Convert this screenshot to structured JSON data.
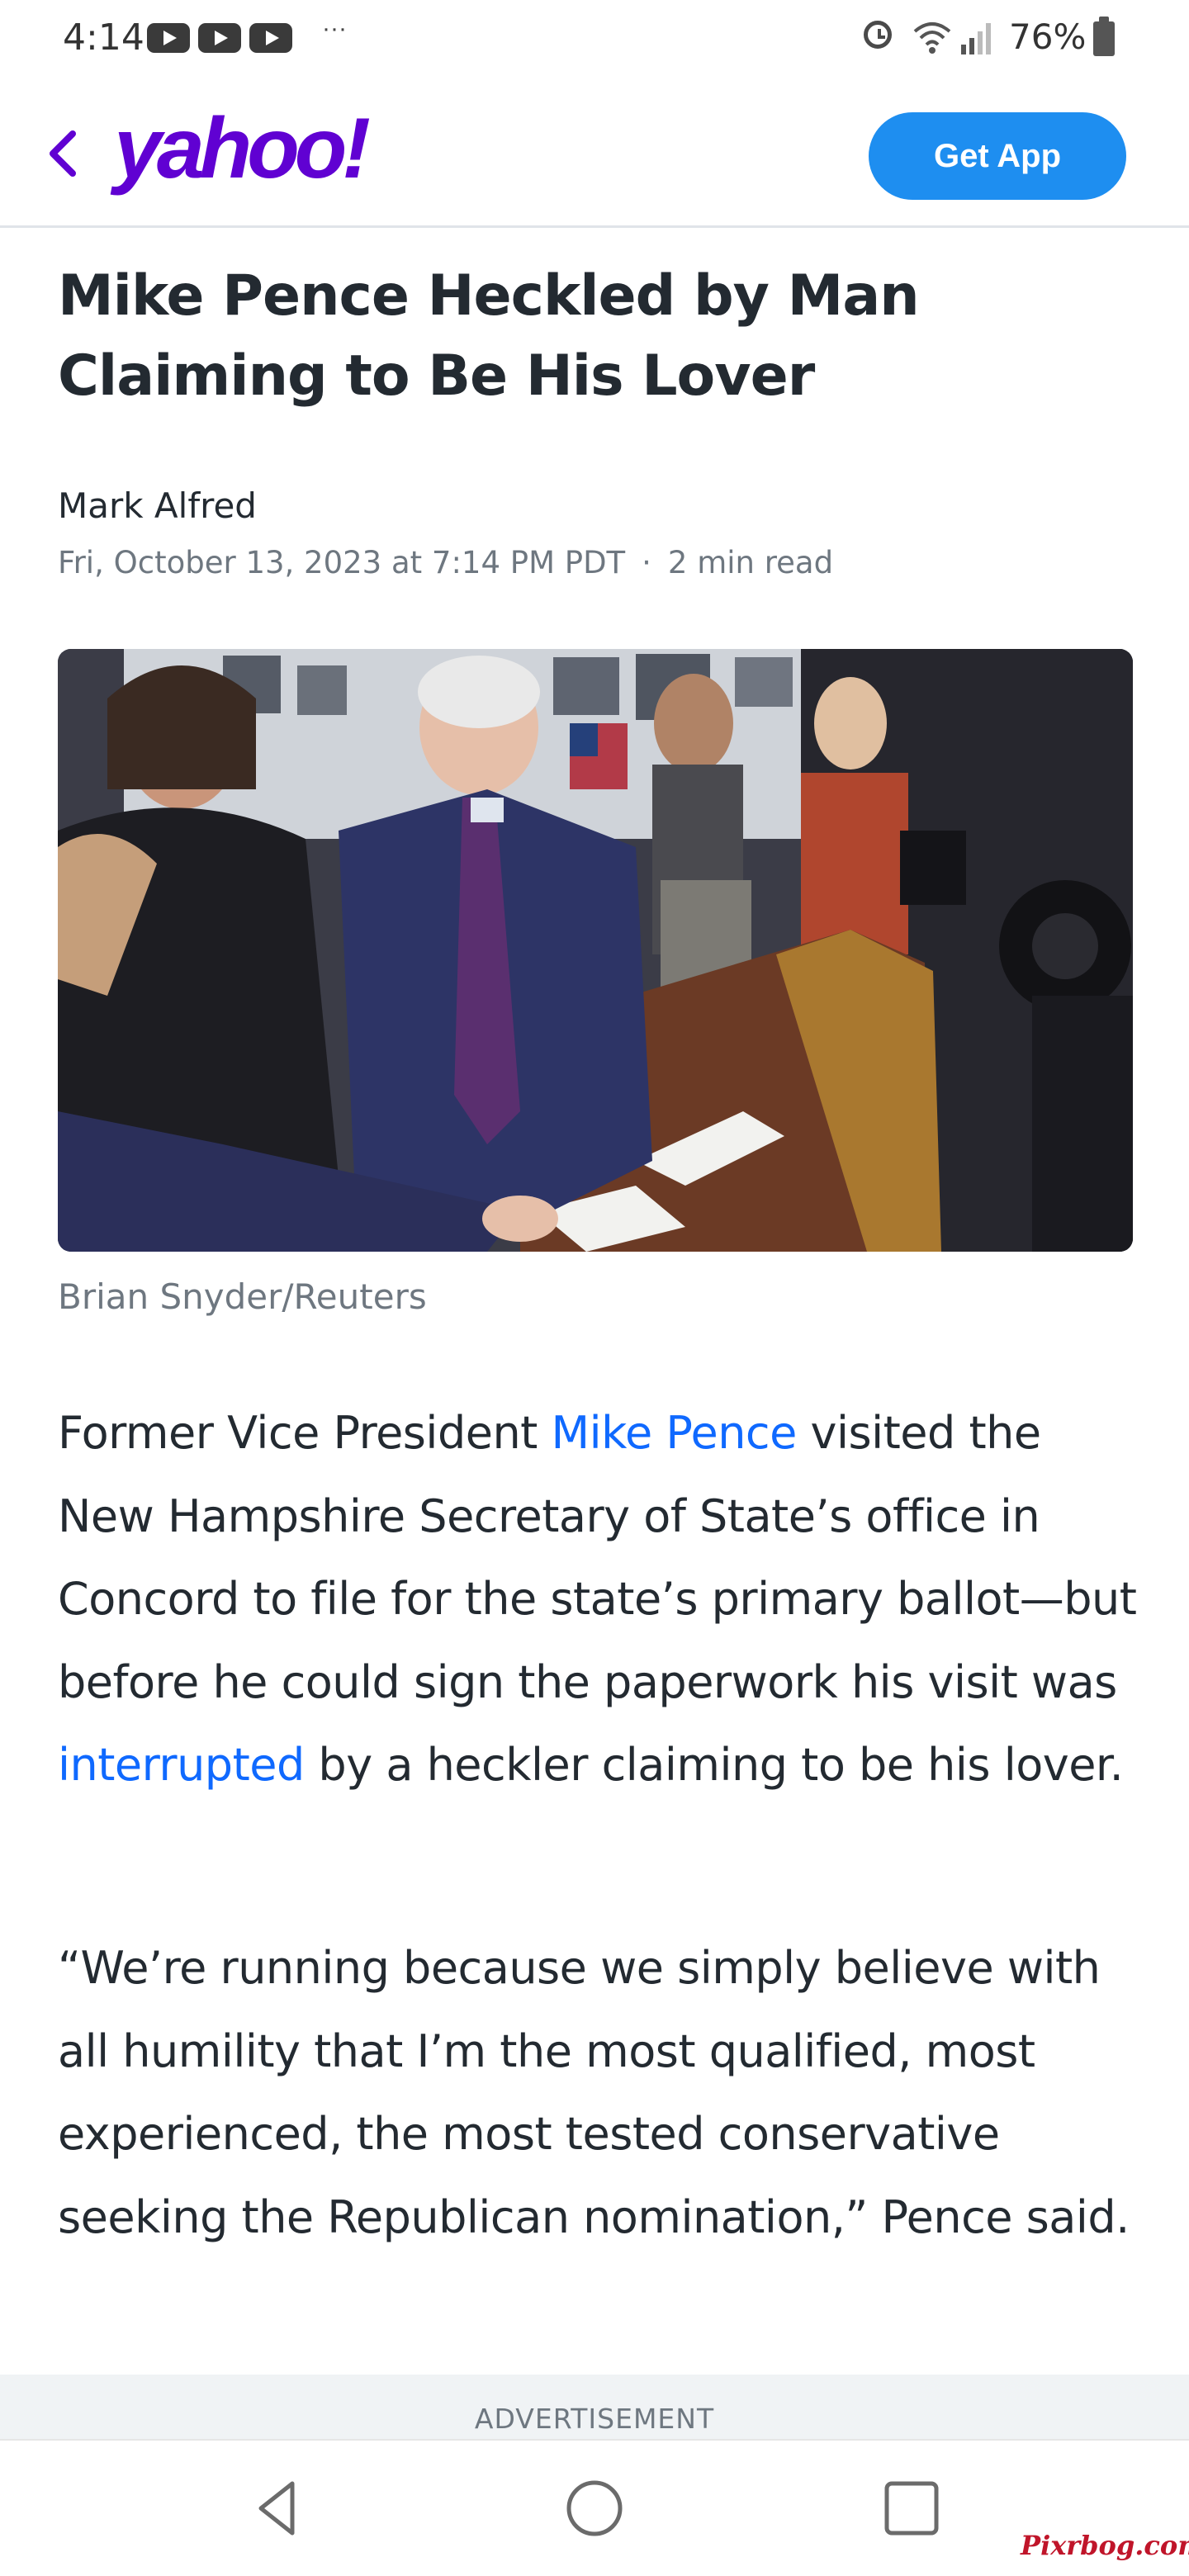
{
  "status_bar": {
    "time": "4:14",
    "more": "···",
    "battery": "76%"
  },
  "header": {
    "logo": "yahoo!",
    "get_app_label": "Get App",
    "accent_color": "#6001d2",
    "button_color": "#1e8ef0"
  },
  "article": {
    "title_line1": "Mike Pence Heckled by Man",
    "title_line2": "Claiming to Be His Lover",
    "author": "Mark Alfred",
    "date": "Fri, October 13, 2023 at 7:14 PM PDT",
    "separator": "·",
    "read_time": "2 min read",
    "photo_credit": "Brian Snyder/Reuters",
    "p1": {
      "before_link1": "Former Vice President ",
      "link1": "Mike Pence",
      "after_link1": " visited the New Hampshire Secretary of State’s office in Concord to file for the state’s primary ballot—but before he could sign the paperwork his visit was ",
      "link2": "interrupted",
      "after_link2": " by a heckler claiming to be his lover."
    },
    "p2": "“We’re running because we simply believe with all humility that I’m the most qualified, most experienced, the most tested conservative seeking the Republican nomination,” Pence said.",
    "link_color": "#0f69ff"
  },
  "ad": {
    "label": "ADVERTISEMENT"
  },
  "watermark": "Pixrbog.com"
}
